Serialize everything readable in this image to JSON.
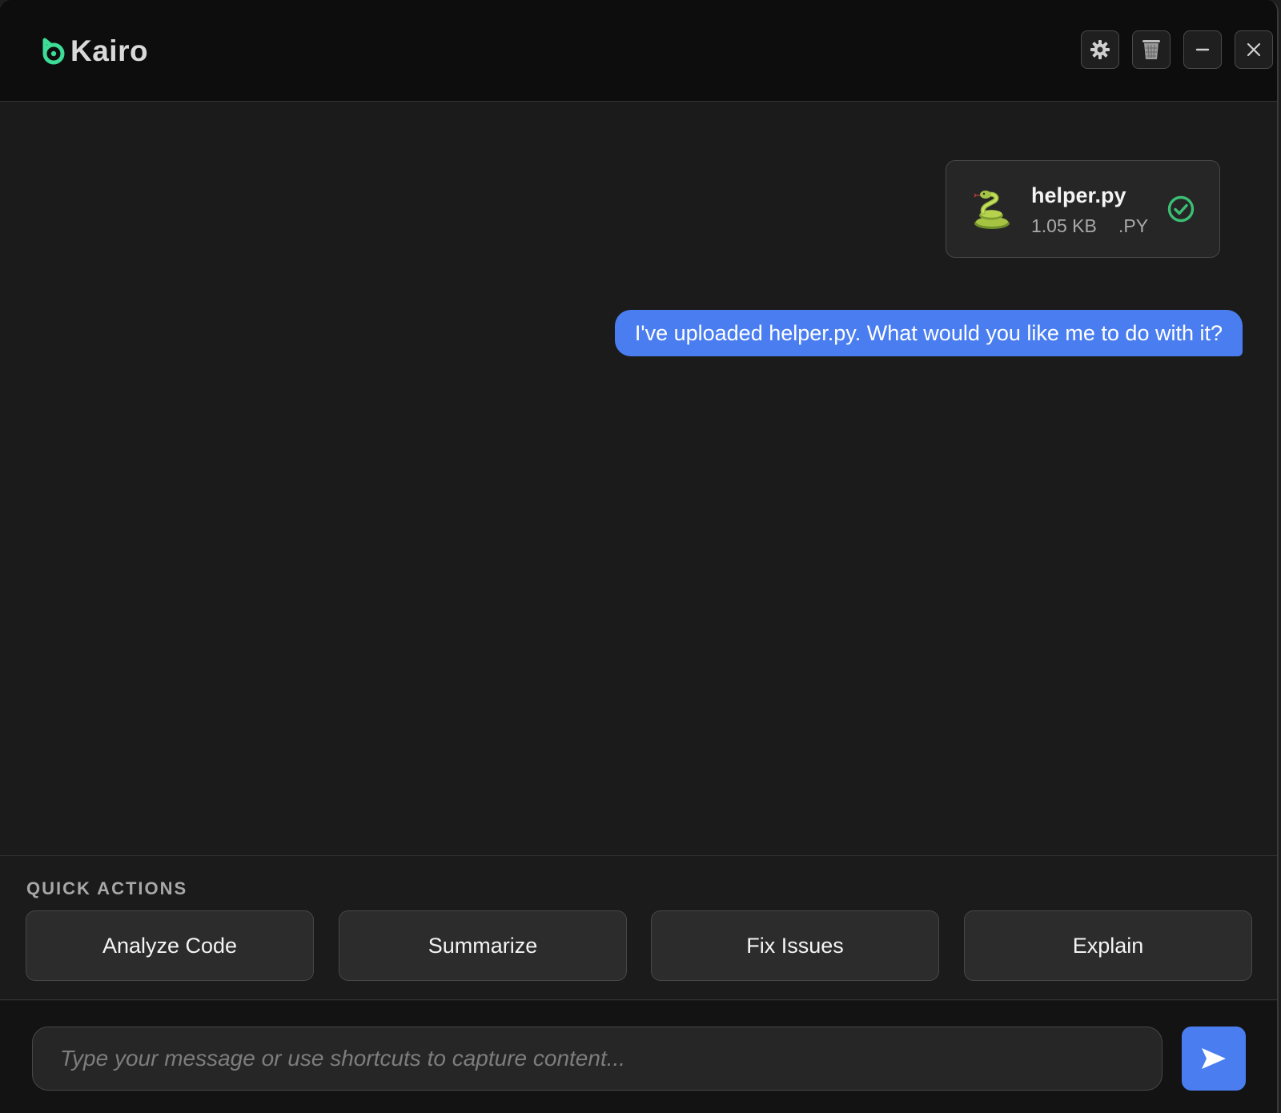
{
  "app": {
    "name": "Kairo",
    "accent_color": "#4a7ef0",
    "logo_color": "#3ddc97"
  },
  "header": {
    "buttons": [
      {
        "name": "settings-button",
        "icon": "gear-icon"
      },
      {
        "name": "clear-chat-button",
        "icon": "trash-icon"
      },
      {
        "name": "minimize-button",
        "icon": "minus-icon"
      },
      {
        "name": "close-button",
        "icon": "close-icon"
      }
    ]
  },
  "chat": {
    "file": {
      "icon": "snake-icon",
      "name": "helper.py",
      "size": "1.05 KB",
      "extension": ".PY",
      "status_icon": "check-circle-icon",
      "status_color": "#3bbf73"
    },
    "message": "I've uploaded helper.py. What would you like me to do with it?"
  },
  "quick_actions": {
    "label": "QUICK ACTIONS",
    "buttons": [
      "Analyze Code",
      "Summarize",
      "Fix Issues",
      "Explain"
    ]
  },
  "composer": {
    "placeholder": "Type your message or use shortcuts to capture content...",
    "value": "",
    "send_icon": "send-icon"
  }
}
